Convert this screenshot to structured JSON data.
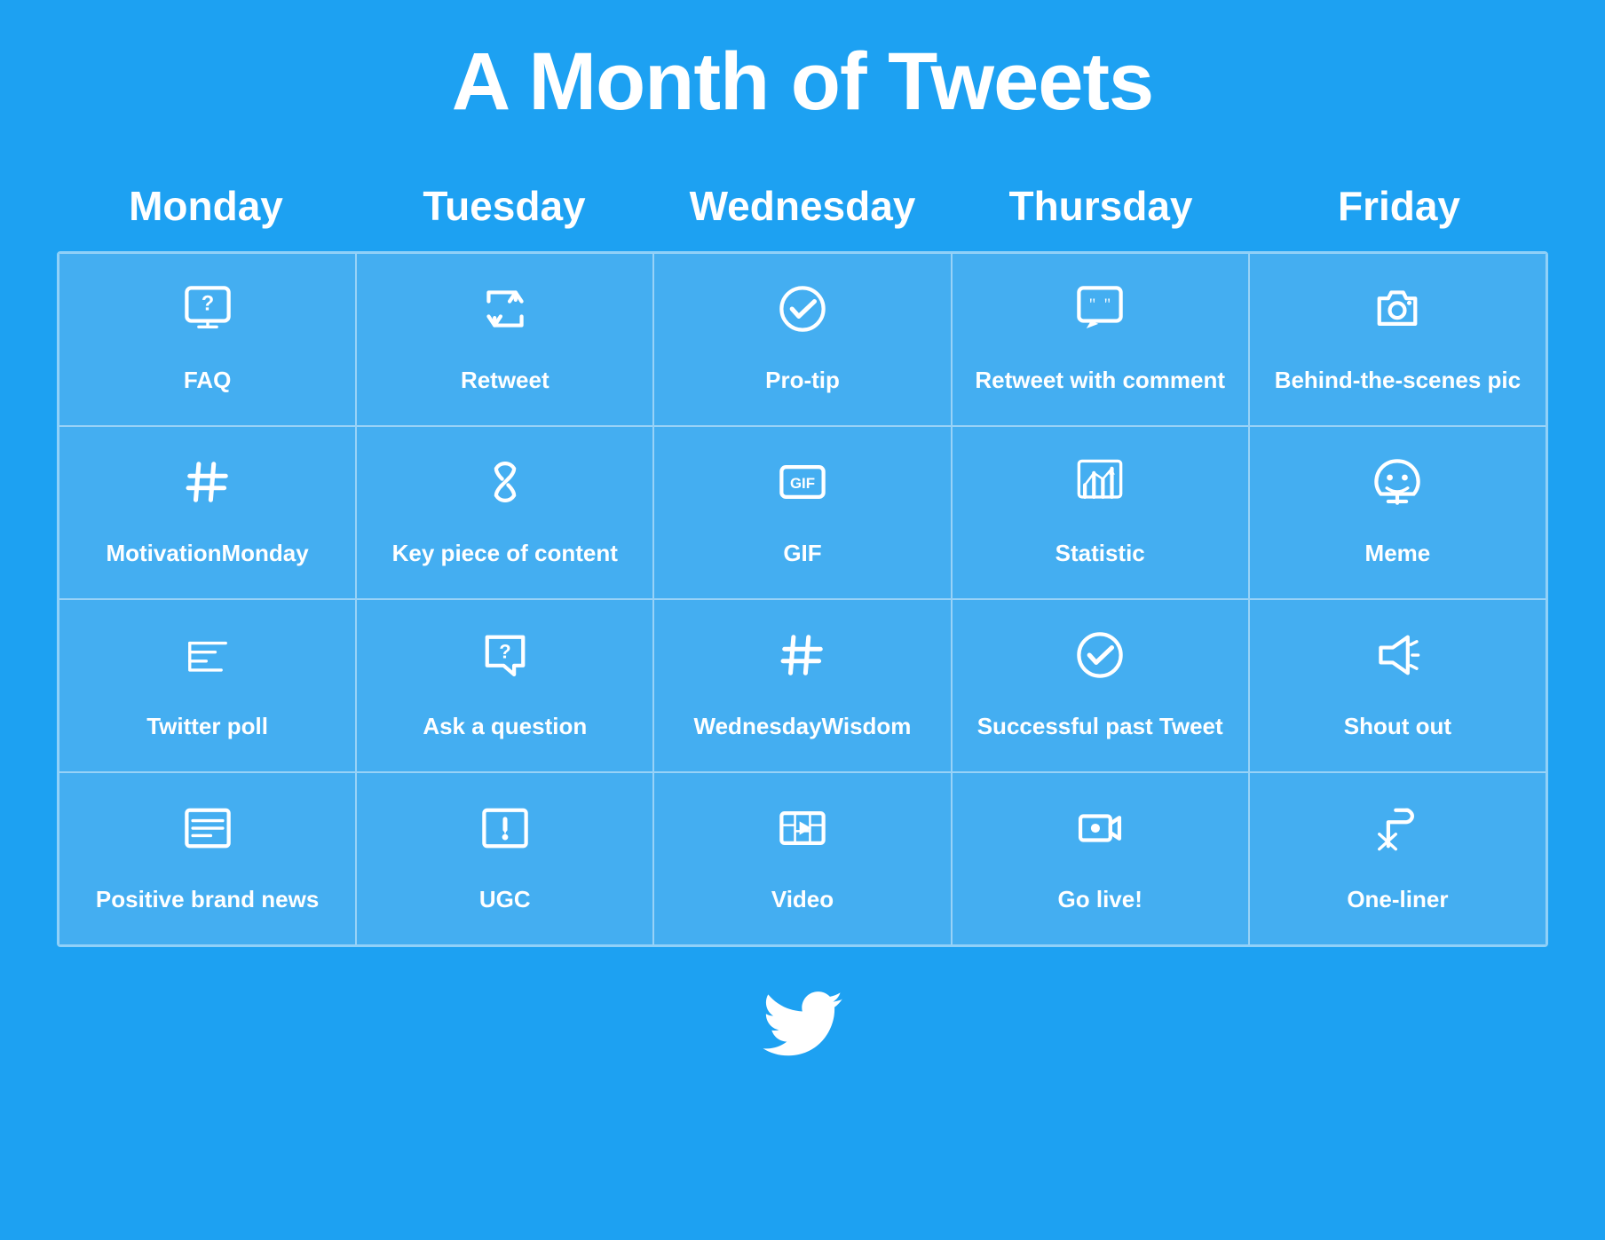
{
  "page": {
    "title": "A Month of Tweets",
    "background_color": "#1DA1F2"
  },
  "days": [
    {
      "label": "Monday"
    },
    {
      "label": "Tuesday"
    },
    {
      "label": "Wednesday"
    },
    {
      "label": "Thursday"
    },
    {
      "label": "Friday"
    }
  ],
  "cells": [
    {
      "row": 1,
      "col": 1,
      "icon": "faq",
      "label": "FAQ"
    },
    {
      "row": 1,
      "col": 2,
      "icon": "retweet",
      "label": "Retweet"
    },
    {
      "row": 1,
      "col": 3,
      "icon": "protip",
      "label": "Pro-tip"
    },
    {
      "row": 1,
      "col": 4,
      "icon": "retweet-comment",
      "label": "Retweet with comment"
    },
    {
      "row": 1,
      "col": 5,
      "icon": "camera",
      "label": "Behind-the-scenes pic"
    },
    {
      "row": 2,
      "col": 1,
      "icon": "hashtag",
      "label": "MotivationMonday"
    },
    {
      "row": 2,
      "col": 2,
      "icon": "link",
      "label": "Key piece of content"
    },
    {
      "row": 2,
      "col": 3,
      "icon": "gif",
      "label": "GIF"
    },
    {
      "row": 2,
      "col": 4,
      "icon": "statistic",
      "label": "Statistic"
    },
    {
      "row": 2,
      "col": 5,
      "icon": "meme",
      "label": "Meme"
    },
    {
      "row": 3,
      "col": 1,
      "icon": "poll",
      "label": "Twitter poll"
    },
    {
      "row": 3,
      "col": 2,
      "icon": "question",
      "label": "Ask a question"
    },
    {
      "row": 3,
      "col": 3,
      "icon": "hashtag",
      "label": "WednesdayWisdom"
    },
    {
      "row": 3,
      "col": 4,
      "icon": "checkmark",
      "label": "Successful past Tweet"
    },
    {
      "row": 3,
      "col": 5,
      "icon": "shoutout",
      "label": "Shout out"
    },
    {
      "row": 4,
      "col": 1,
      "icon": "news",
      "label": "Positive brand news"
    },
    {
      "row": 4,
      "col": 2,
      "icon": "ugc",
      "label": "UGC"
    },
    {
      "row": 4,
      "col": 3,
      "icon": "video",
      "label": "Video"
    },
    {
      "row": 4,
      "col": 4,
      "icon": "live",
      "label": "Go live!"
    },
    {
      "row": 4,
      "col": 5,
      "icon": "oneliner",
      "label": "One-liner"
    }
  ]
}
